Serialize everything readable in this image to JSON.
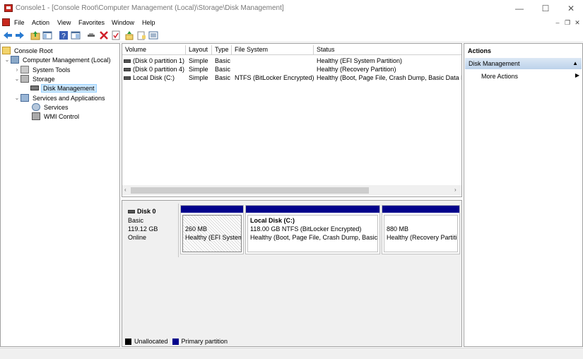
{
  "window": {
    "title": "Console1 - [Console Root\\Computer Management (Local)\\Storage\\Disk Management]",
    "minimize_glyph": "—",
    "maximize_glyph": "☐",
    "close_glyph": "✕"
  },
  "menubar": {
    "items": [
      "File",
      "Action",
      "View",
      "Favorites",
      "Window",
      "Help"
    ],
    "mdi_min": "–",
    "mdi_restore": "❐",
    "mdi_close": "✕"
  },
  "toolbar": {
    "icons": [
      "back-arrow-icon",
      "forward-arrow-icon",
      "up-folder-icon",
      "show-hide-tree-icon",
      "help-icon",
      "properties-icon",
      "connect-icon",
      "delete-icon",
      "check-icon",
      "import-icon",
      "export-icon",
      "view-icon"
    ]
  },
  "tree": {
    "items": [
      {
        "label": "Console Root",
        "icon": "folder-icon",
        "expander": ""
      },
      {
        "label": "Computer Management (Local)",
        "icon": "computer-management-icon",
        "expander": "⌄"
      },
      {
        "label": "System Tools",
        "icon": "system-tools-icon",
        "expander": "›"
      },
      {
        "label": "Storage",
        "icon": "storage-icon",
        "expander": "⌄"
      },
      {
        "label": "Disk Management",
        "icon": "disk-management-icon",
        "expander": ""
      },
      {
        "label": "Services and Applications",
        "icon": "services-apps-icon",
        "expander": "⌄"
      },
      {
        "label": "Services",
        "icon": "services-icon",
        "expander": ""
      },
      {
        "label": "WMI Control",
        "icon": "wmi-control-icon",
        "expander": ""
      }
    ]
  },
  "volumes": {
    "headers": [
      "Volume",
      "Layout",
      "Type",
      "File System",
      "Status"
    ],
    "rows": [
      {
        "volume": "(Disk 0 partition 1)",
        "layout": "Simple",
        "type": "Basic",
        "fs": "",
        "status": "Healthy (EFI System Partition)"
      },
      {
        "volume": "(Disk 0 partition 4)",
        "layout": "Simple",
        "type": "Basic",
        "fs": "",
        "status": "Healthy (Recovery Partition)"
      },
      {
        "volume": "Local Disk (C:)",
        "layout": "Simple",
        "type": "Basic",
        "fs": "NTFS (BitLocker Encrypted)",
        "status": "Healthy (Boot, Page File, Crash Dump, Basic Data Pa"
      }
    ],
    "scroll_left": "‹",
    "scroll_right": "›"
  },
  "disk": {
    "name": "Disk 0",
    "kind": "Basic",
    "size": "119.12 GB",
    "state": "Online",
    "partitions": [
      {
        "title": "",
        "line1": "260 MB",
        "line2": "Healthy (EFI System",
        "hatched": true
      },
      {
        "title": "Local Disk  (C:)",
        "line1": "118.00 GB NTFS (BitLocker Encrypted)",
        "line2": "Healthy (Boot, Page File, Crash Dump, Basic D",
        "hatched": false
      },
      {
        "title": "",
        "line1": "880 MB",
        "line2": "Healthy (Recovery Partitic",
        "hatched": false
      }
    ]
  },
  "legend": [
    {
      "label": "Unallocated",
      "color": "#000000"
    },
    {
      "label": "Primary partition",
      "color": "#00008b"
    }
  ],
  "actions": {
    "header": "Actions",
    "section": "Disk Management",
    "more": "More Actions",
    "section_caret": "▲",
    "more_caret": "▶"
  },
  "colors": {
    "primary_partition": "#00008b",
    "selection": "#cce8ff"
  }
}
